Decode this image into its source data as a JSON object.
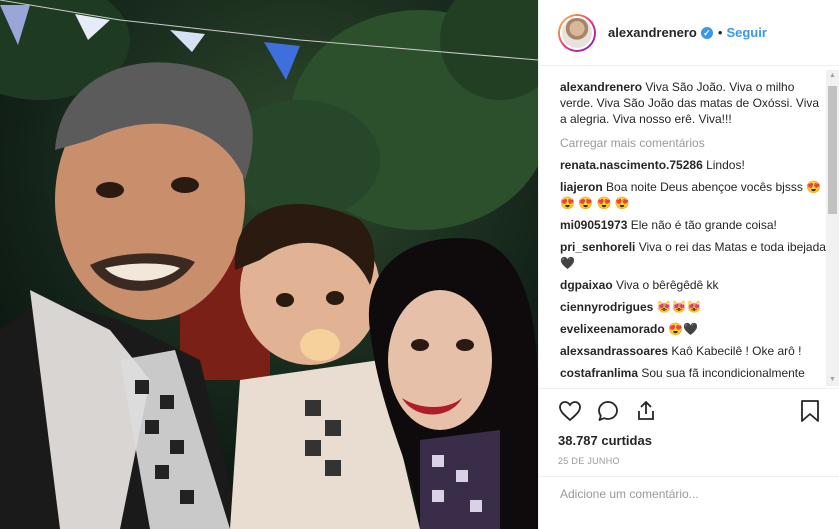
{
  "post": {
    "username": "alexandrenero",
    "verified_mark": "✓",
    "separator": "•",
    "follow_label": "Seguir",
    "caption": "Viva São João. Viva o milho verde. Viva São João das matas de Oxóssi. Viva a alegria. Viva nosso erê. Viva!!!",
    "load_more": "Carregar mais comentários",
    "comments": [
      {
        "user": "renata.nascimento.75286",
        "text": "Lindos!"
      },
      {
        "user": "liajeron",
        "text": "Boa noite Deus abençoe vocês bjsss 😍 😍 😍 😍 😍"
      },
      {
        "user": "mi09051973",
        "text": "Ele não é tão grande coisa!"
      },
      {
        "user": "pri_senhoreli",
        "text": "Viva o rei das Matas e toda ibejada🖤"
      },
      {
        "user": "dgpaixao",
        "text": "Viva o bêrêgêdê kk"
      },
      {
        "user": "ciennyrodrigues",
        "text": "😻😻😻"
      },
      {
        "user": "evelixeenamorado",
        "text": "😍🖤"
      },
      {
        "user": "alexsandrassoares",
        "text": "Kaô Kabecilê ! Oke arô !"
      },
      {
        "user": "costafranlima",
        "text": "Sou sua fã incondicionalmente"
      }
    ],
    "likes": "38.787 curtidas",
    "date": "25 DE JUNHO",
    "comment_placeholder": "Adicione um comentário..."
  },
  "icons": {
    "like": "heart-icon",
    "comment": "comment-bubble-icon",
    "share": "share-icon",
    "save": "bookmark-icon"
  },
  "colors": {
    "accent": "#3897f0",
    "text": "#262626",
    "muted": "#999999"
  }
}
